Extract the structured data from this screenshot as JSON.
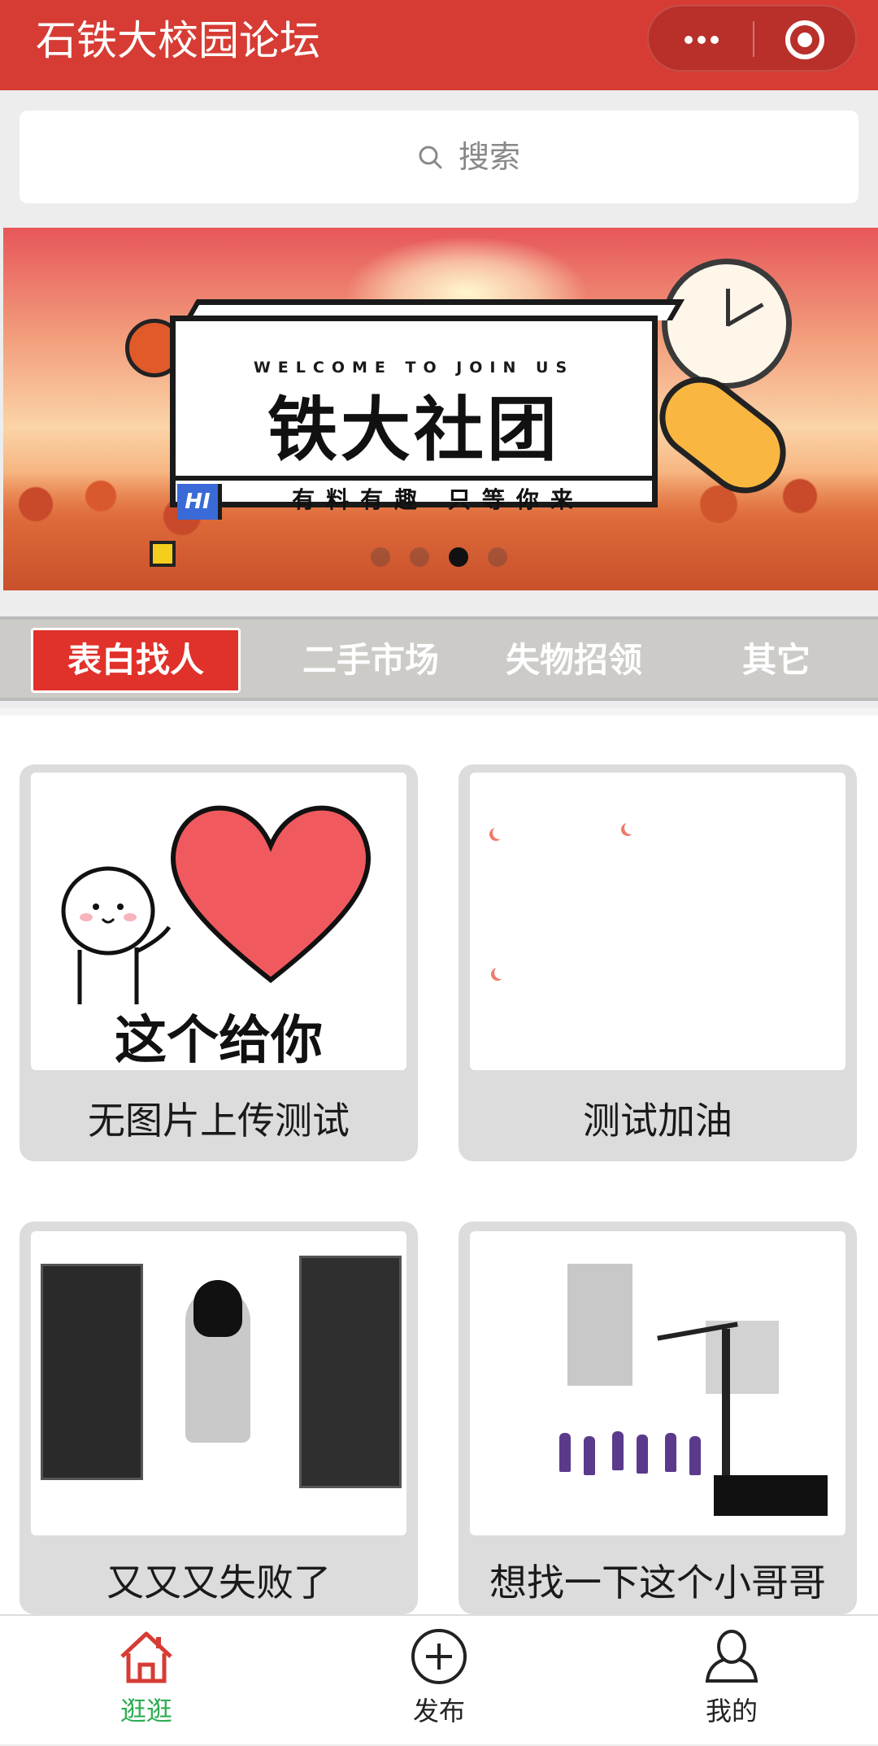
{
  "header": {
    "title": "石铁大校园论坛",
    "more_icon": "more-dots-icon",
    "close_icon": "target-circle-icon"
  },
  "search": {
    "placeholder": "搜索",
    "icon": "search-icon"
  },
  "banner": {
    "welcome": "WELCOME TO JOIN US",
    "headline": "铁大社团",
    "badge": "HI",
    "tagline": "有料有趣 只等你来",
    "slide_count": 4,
    "active_slide": 3
  },
  "tabs": [
    {
      "label": "表白找人",
      "active": true
    },
    {
      "label": "二手市场",
      "active": false
    },
    {
      "label": "失物招领",
      "active": false
    },
    {
      "label": "其它",
      "active": false
    }
  ],
  "posts": [
    {
      "title": "无图片上传测试",
      "image_text": "这个给你"
    },
    {
      "title": "测试加油"
    },
    {
      "title": "又又又失败了"
    },
    {
      "title": "想找一下这个小哥哥"
    }
  ],
  "nav": [
    {
      "label": "逛逛",
      "icon": "home-icon",
      "active": true
    },
    {
      "label": "发布",
      "icon": "plus-circle-icon",
      "active": false
    },
    {
      "label": "我的",
      "icon": "user-icon",
      "active": false
    }
  ],
  "colors": {
    "header_bg": "#d63c34",
    "tab_active": "#e0312a",
    "nav_active": "#2fae53"
  }
}
